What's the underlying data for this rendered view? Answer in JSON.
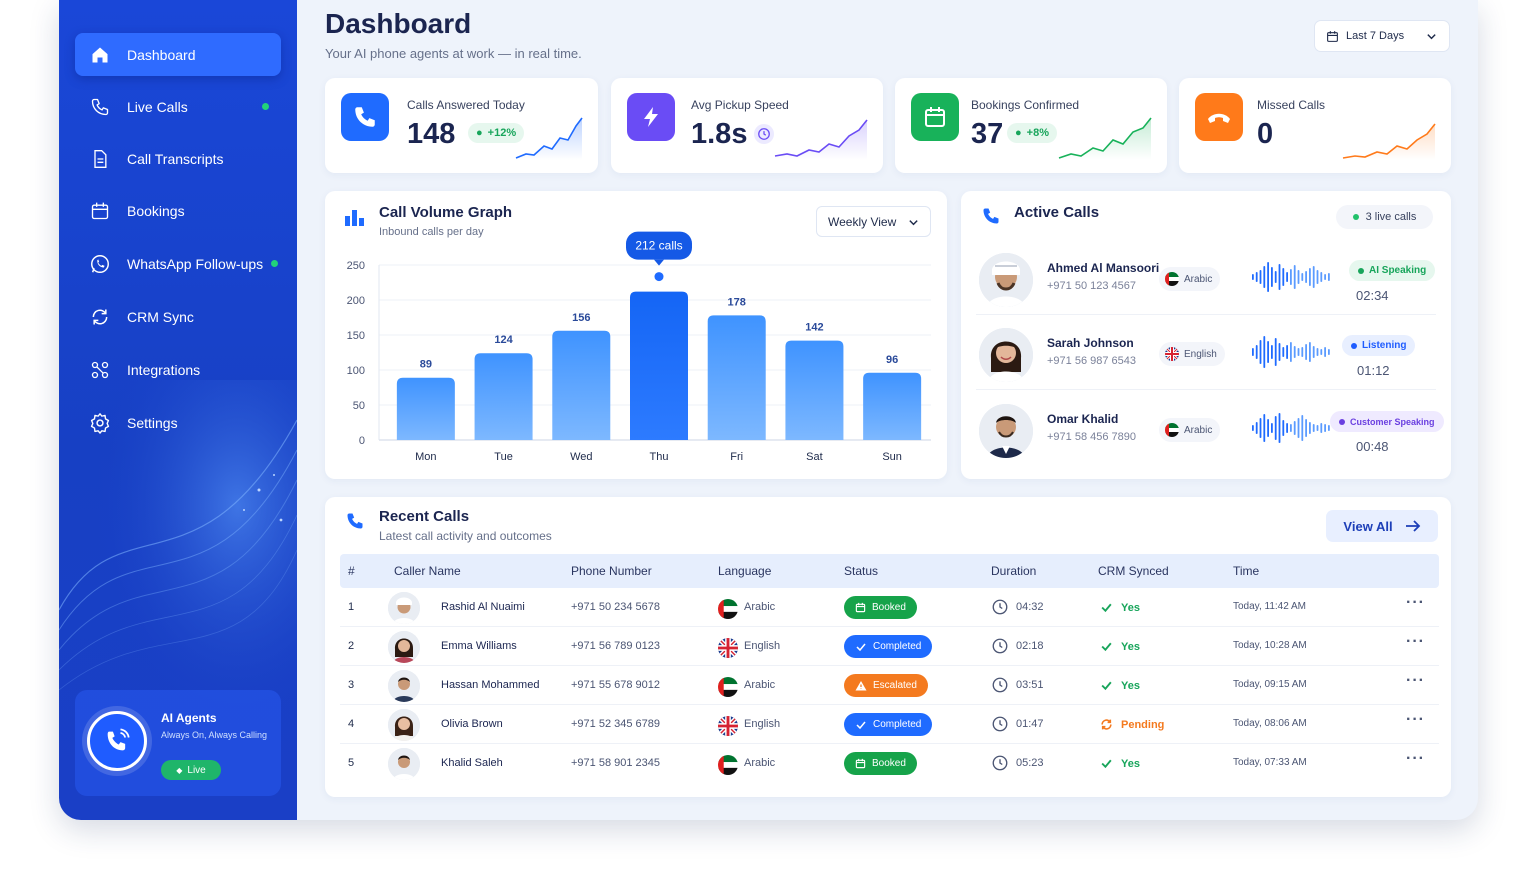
{
  "sidebar": {
    "items": [
      {
        "label": "Dashboard",
        "icon": "home-icon",
        "active": true
      },
      {
        "label": "Live Calls",
        "icon": "phone-icon"
      },
      {
        "label": "Call Transcripts",
        "icon": "document-icon"
      },
      {
        "label": "Bookings",
        "icon": "calendar-icon"
      },
      {
        "label": "WhatsApp Follow-ups",
        "icon": "whatsapp-icon"
      },
      {
        "label": "CRM Sync",
        "icon": "sync-icon"
      },
      {
        "label": "Integrations",
        "icon": "integrations-icon"
      },
      {
        "label": "Settings",
        "icon": "gear-icon"
      }
    ],
    "agent_card": {
      "title": "AI Agents",
      "subtitle": "Always On, Always Calling",
      "status": "Live"
    }
  },
  "header": {
    "title": "Dashboard",
    "subtitle": "Your AI phone agents at work — in real time.",
    "range": "Last 7 Days"
  },
  "stats": [
    {
      "label": "Calls Answered Today",
      "value": "148",
      "badge": "+12%",
      "color": "#1f6bff",
      "icon": "phone-icon"
    },
    {
      "label": "Avg Pickup Speed",
      "value": "1.8s",
      "badge": "",
      "color": "#6a4cf5",
      "icon": "bolt-icon"
    },
    {
      "label": "Bookings Confirmed",
      "value": "37",
      "badge": "+8%",
      "color": "#18b25a",
      "icon": "calendar-icon"
    },
    {
      "label": "Missed Calls",
      "value": "0",
      "badge": "",
      "color": "#ff7a1a",
      "icon": "phone-hangup-icon"
    }
  ],
  "call_volume": {
    "title": "Call Volume Graph",
    "subtitle": "Inbound calls per day",
    "view": "Weekly View",
    "tooltip": "212 calls"
  },
  "chart_data": {
    "type": "bar",
    "categories": [
      "Mon",
      "Tue",
      "Wed",
      "Thu",
      "Fri",
      "Sat",
      "Sun"
    ],
    "values": [
      89,
      124,
      156,
      212,
      178,
      142,
      96
    ],
    "yticks": [
      0,
      50,
      100,
      150,
      200,
      250
    ],
    "ylim": [
      0,
      250
    ],
    "highlight": "Thu",
    "grid": true,
    "colors": {
      "bar": "#4a9cff",
      "highlight": "#1f6bff"
    }
  },
  "active_calls": {
    "title": "Active Calls",
    "count_label": "3 live calls",
    "calls": [
      {
        "name": "Ahmed Al Mansoori",
        "phone": "+971 50 123 4567",
        "language": "Arabic",
        "flag": "uae",
        "status": "AI Speaking",
        "status_color": "#18a55b",
        "status_bg": "#e6f7ee",
        "duration": "02:34"
      },
      {
        "name": "Sarah Johnson",
        "phone": "+971 56 987 6543",
        "language": "English",
        "flag": "uk",
        "status": "Listening",
        "status_color": "#1f5cff",
        "status_bg": "#e8efff",
        "duration": "01:12"
      },
      {
        "name": "Omar Khalid",
        "phone": "+971 58 456 7890",
        "language": "Arabic",
        "flag": "uae",
        "status": "Customer Speaking",
        "status_color": "#6a3fe0",
        "status_bg": "#efeaff",
        "duration": "00:48"
      }
    ]
  },
  "recent_calls": {
    "title": "Recent Calls",
    "subtitle": "Latest call activity and outcomes",
    "view_all": "View All",
    "columns": [
      "#",
      "Caller Name",
      "Phone Number",
      "Language",
      "Status",
      "Duration",
      "CRM Synced",
      "Time"
    ],
    "rows": [
      {
        "num": "1",
        "name": "Rashid Al Nuaimi",
        "phone": "+971 50 234 5678",
        "language": "Arabic",
        "flag": "uae",
        "status": "Booked",
        "status_color": "#16a34a",
        "duration": "04:32",
        "crm": "Yes",
        "time": "Today, 11:42 AM"
      },
      {
        "num": "2",
        "name": "Emma Williams",
        "phone": "+971 56 789 0123",
        "language": "English",
        "flag": "uk",
        "status": "Completed",
        "status_color": "#1f6bff",
        "duration": "02:18",
        "crm": "Yes",
        "time": "Today, 10:28 AM"
      },
      {
        "num": "3",
        "name": "Hassan Mohammed",
        "phone": "+971 55 678 9012",
        "language": "Arabic",
        "flag": "uae",
        "status": "Escalated",
        "status_color": "#f47a1f",
        "duration": "03:51",
        "crm": "Yes",
        "time": "Today, 09:15 AM"
      },
      {
        "num": "4",
        "name": "Olivia Brown",
        "phone": "+971 52 345 6789",
        "language": "English",
        "flag": "uk",
        "status": "Completed",
        "status_color": "#1f6bff",
        "duration": "01:47",
        "crm": "Pending",
        "time": "Today, 08:06 AM"
      },
      {
        "num": "5",
        "name": "Khalid Saleh",
        "phone": "+971 58 901 2345",
        "language": "Arabic",
        "flag": "uae",
        "status": "Booked",
        "status_color": "#16a34a",
        "duration": "05:23",
        "crm": "Yes",
        "time": "Today, 07:33 AM"
      }
    ]
  }
}
